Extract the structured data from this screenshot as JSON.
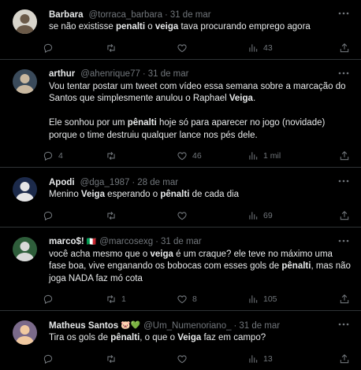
{
  "tweets": [
    {
      "name": "Barbara",
      "badge": "",
      "handle": "@torraca_barbara",
      "dot": "·",
      "time": "31 de mar",
      "text": [
        {
          "t": "se não existisse ",
          "b": false
        },
        {
          "t": "penalti",
          "b": true
        },
        {
          "t": " o ",
          "b": false
        },
        {
          "t": "veiga",
          "b": true
        },
        {
          "t": " tava procurando emprego agora",
          "b": false
        }
      ],
      "replies": "",
      "retweets": "",
      "likes": "",
      "views": "43",
      "avatar": {
        "bg": "#d8d5cc",
        "fg": "#6b5a48"
      }
    },
    {
      "name": "arthur",
      "badge": "",
      "handle": "@ahenrique77",
      "dot": "·",
      "time": "31 de mar",
      "text": [
        {
          "t": "Vou tentar postar um tweet com vídeo essa semana sobre a marcação do Santos que simplesmente anulou o Raphael ",
          "b": false
        },
        {
          "t": "Veiga",
          "b": true
        },
        {
          "t": ".\n\nEle sonhou por um ",
          "b": false
        },
        {
          "t": "pênalti",
          "b": true
        },
        {
          "t": " hoje só para aparecer no jogo (novidade) porque o time destruiu qualquer lance nos pés dele.",
          "b": false
        }
      ],
      "replies": "4",
      "retweets": "",
      "likes": "46",
      "views": "1 mil",
      "avatar": {
        "bg": "#3a4a5a",
        "fg": "#c9b8a0"
      }
    },
    {
      "name": "Apodi",
      "badge": "",
      "handle": "@dga_1987",
      "dot": "·",
      "time": "28 de mar",
      "text": [
        {
          "t": "Menino ",
          "b": false
        },
        {
          "t": "Veiga",
          "b": true
        },
        {
          "t": " esperando o ",
          "b": false
        },
        {
          "t": "pênalti",
          "b": true
        },
        {
          "t": " de cada dia",
          "b": false
        }
      ],
      "replies": "",
      "retweets": "",
      "likes": "",
      "views": "69",
      "avatar": {
        "bg": "#1c2a4a",
        "fg": "#e6e6e6"
      }
    },
    {
      "name": "marco$!",
      "badge": "🇮🇹",
      "handle": "@marcosexg",
      "dot": "·",
      "time": "31 de mar",
      "text": [
        {
          "t": "você acha mesmo que o ",
          "b": false
        },
        {
          "t": "veiga",
          "b": true
        },
        {
          "t": " é um craque? ele teve no máximo uma fase boa, vive enganando os bobocas com esses gols de ",
          "b": false
        },
        {
          "t": "pênalti",
          "b": true
        },
        {
          "t": ", mas não joga NADA faz mó cota",
          "b": false
        }
      ],
      "replies": "",
      "retweets": "1",
      "likes": "8",
      "views": "105",
      "avatar": {
        "bg": "#2e5d3a",
        "fg": "#d9d9d9"
      }
    },
    {
      "name": "Matheus Santos",
      "badge": "🐷💚",
      "handle": "@Um_Numenoriano_",
      "dot": "·",
      "time": "31 de mar",
      "text": [
        {
          "t": "Tira os gols de ",
          "b": false
        },
        {
          "t": "pênalti",
          "b": true
        },
        {
          "t": ", o que o ",
          "b": false
        },
        {
          "t": "Veiga",
          "b": true
        },
        {
          "t": " faz em campo?",
          "b": false
        }
      ],
      "replies": "",
      "retweets": "",
      "likes": "",
      "views": "13",
      "avatar": {
        "bg": "#7a6a8a",
        "fg": "#f0c9a0"
      }
    }
  ],
  "icons": {
    "more": "more-horizontal-icon",
    "reply": "reply-icon",
    "retweet": "retweet-icon",
    "like": "heart-icon",
    "views": "views-icon",
    "share": "share-icon"
  }
}
